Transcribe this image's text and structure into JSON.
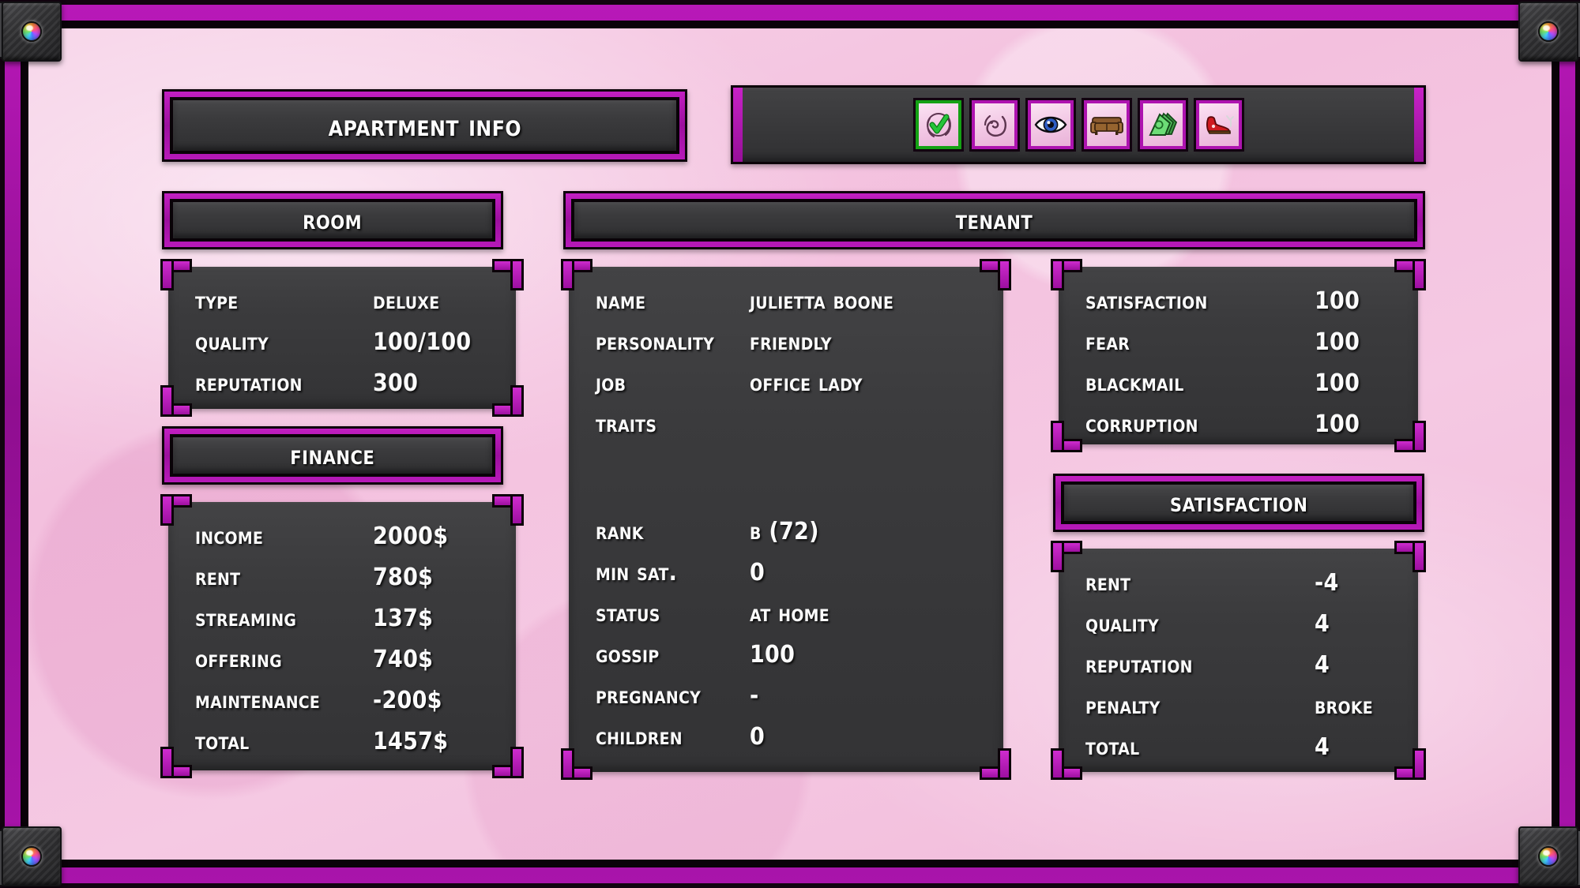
{
  "window": {
    "accent_magenta": "#b818b8",
    "background_pink": "#f3c0de",
    "panel_dark": "#3b3b3d",
    "active_border_green": "#14a114"
  },
  "headers": {
    "apartment_info": "Apartment info",
    "room": "Room",
    "finance": "Finance",
    "tenant": "Tenant",
    "satisfaction": "Satisfaction"
  },
  "icon_bar": {
    "items": [
      {
        "name": "approve-icon",
        "label": "Approve",
        "active": true
      },
      {
        "name": "mood-icon",
        "label": "Mood",
        "active": false
      },
      {
        "name": "eye-icon",
        "label": "Observe",
        "active": false
      },
      {
        "name": "couch-icon",
        "label": "Furniture",
        "active": false
      },
      {
        "name": "money-icon",
        "label": "Money",
        "active": false
      },
      {
        "name": "boot-icon",
        "label": "Evict",
        "active": false
      }
    ]
  },
  "room": {
    "rows": [
      {
        "key": "Type",
        "value": "Deluxe"
      },
      {
        "key": "Quality",
        "value": "100/100"
      },
      {
        "key": "Reputation",
        "value": "300"
      }
    ]
  },
  "finance": {
    "rows": [
      {
        "key": "Income",
        "value": "2000$"
      },
      {
        "key": "Rent",
        "value": "780$"
      },
      {
        "key": "Streaming",
        "value": "137$"
      },
      {
        "key": "Offering",
        "value": "740$"
      },
      {
        "key": "Maintenance",
        "value": "-200$"
      },
      {
        "key": "Total",
        "value": "1457$"
      }
    ]
  },
  "tenant": {
    "rows_top": [
      {
        "key": "Name",
        "value": "Julietta Boone"
      },
      {
        "key": "Personality",
        "value": "Friendly"
      },
      {
        "key": "Job",
        "value": "Office Lady"
      },
      {
        "key": "Traits",
        "value": ""
      }
    ],
    "rows_bottom": [
      {
        "key": "Rank",
        "value": "B (72)"
      },
      {
        "key": "Min Sat.",
        "value": "0"
      },
      {
        "key": "Status",
        "value": "At home"
      },
      {
        "key": "Gossip",
        "value": "100"
      },
      {
        "key": "Pregnancy",
        "value": "-"
      },
      {
        "key": "Children",
        "value": "0"
      }
    ]
  },
  "stats": {
    "rows": [
      {
        "key": "Satisfaction",
        "value": "100"
      },
      {
        "key": "Fear",
        "value": "100"
      },
      {
        "key": "Blackmail",
        "value": "100"
      },
      {
        "key": "Corruption",
        "value": "100"
      }
    ]
  },
  "satisfaction": {
    "rows": [
      {
        "key": "Rent",
        "value": "-4"
      },
      {
        "key": "Quality",
        "value": "4"
      },
      {
        "key": "Reputation",
        "value": "4"
      },
      {
        "key": "Penalty",
        "value": "Broke"
      },
      {
        "key": "Total",
        "value": "4"
      }
    ]
  }
}
